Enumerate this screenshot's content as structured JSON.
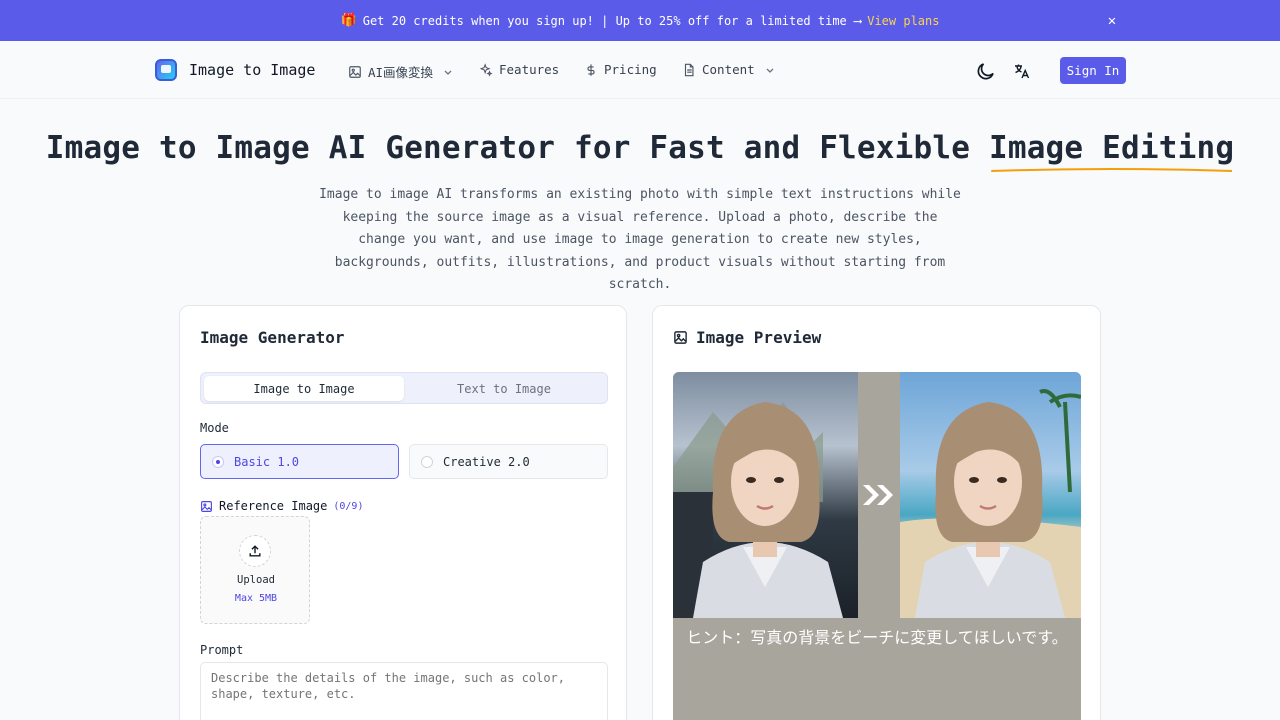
{
  "banner": {
    "text": "Get 20 credits when you sign up! | Up to 25% off for a limited time ⟶",
    "link": "View plans",
    "gift_icon": "🎁"
  },
  "nav": {
    "brand": "Image to Image",
    "items": [
      {
        "label": "AI画像変換",
        "icon": "image-icon",
        "has_dropdown": true
      },
      {
        "label": "Features",
        "icon": "sparkles-icon",
        "has_dropdown": false
      },
      {
        "label": "Pricing",
        "icon": "dollar-icon",
        "has_dropdown": false
      },
      {
        "label": "Content",
        "icon": "document-icon",
        "has_dropdown": true
      }
    ],
    "sign_in": "Sign In"
  },
  "hero": {
    "title_main": "Image to Image AI Generator for Fast and Flexible ",
    "title_highlight": "Image Editing",
    "description": "Image to image AI transforms an existing photo with simple text instructions while keeping the source image as a visual reference. Upload a photo, describe the change you want, and use image to image generation to create new styles, backgrounds, outfits, illustrations, and product visuals without starting from scratch."
  },
  "generator": {
    "title": "Image Generator",
    "tabs": [
      "Image to Image",
      "Text to Image"
    ],
    "active_tab": 0,
    "mode_label": "Mode",
    "modes": [
      "Basic 1.0",
      "Creative 2.0"
    ],
    "selected_mode": 0,
    "reference_label": "Reference Image",
    "reference_count": "(0/9)",
    "upload_label": "Upload",
    "upload_limit": "Max 5MB",
    "prompt_label": "Prompt",
    "prompt_placeholder": "Describe the details of the image, such as color, shape, texture, etc."
  },
  "preview": {
    "title": "Image Preview",
    "hint": "ヒント：写真の背景をビーチに変更してほしいです。"
  },
  "colors": {
    "accent": "#5b5bea",
    "highlight_underline": "#f59e0b",
    "banner_link": "#fcd34d"
  }
}
